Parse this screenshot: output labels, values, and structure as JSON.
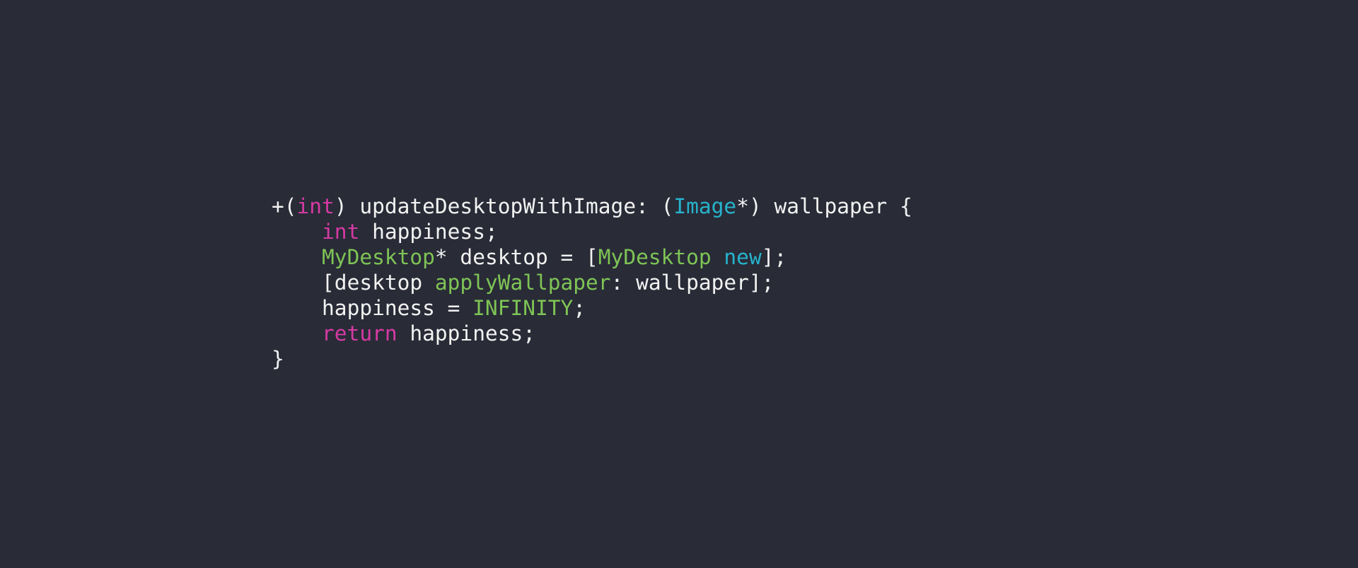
{
  "colors": {
    "background": "#292b37",
    "plain": "#f2f2f2",
    "keyword": "#d63aa4",
    "type": "#26b3cc",
    "class": "#7ec455"
  },
  "code": {
    "lines": [
      [
        {
          "t": "+(",
          "k": "plain"
        },
        {
          "t": "int",
          "k": "kw"
        },
        {
          "t": ") updateDesktopWithImage: (",
          "k": "plain"
        },
        {
          "t": "Image",
          "k": "type"
        },
        {
          "t": "*) wallpaper {",
          "k": "plain"
        }
      ],
      [
        {
          "t": "    ",
          "k": "plain"
        },
        {
          "t": "int",
          "k": "kw"
        },
        {
          "t": " happiness;",
          "k": "plain"
        }
      ],
      [
        {
          "t": "    ",
          "k": "plain"
        },
        {
          "t": "MyDesktop",
          "k": "cls"
        },
        {
          "t": "* desktop = [",
          "k": "plain"
        },
        {
          "t": "MyDesktop",
          "k": "cls"
        },
        {
          "t": " ",
          "k": "plain"
        },
        {
          "t": "new",
          "k": "type"
        },
        {
          "t": "];",
          "k": "plain"
        }
      ],
      [
        {
          "t": "    [desktop ",
          "k": "plain"
        },
        {
          "t": "applyWallpaper",
          "k": "cls"
        },
        {
          "t": ": wallpaper];",
          "k": "plain"
        }
      ],
      [
        {
          "t": "    happiness = ",
          "k": "plain"
        },
        {
          "t": "INFINITY",
          "k": "cls"
        },
        {
          "t": ";",
          "k": "plain"
        }
      ],
      [
        {
          "t": "    ",
          "k": "plain"
        },
        {
          "t": "return",
          "k": "kw"
        },
        {
          "t": " happiness;",
          "k": "plain"
        }
      ],
      [
        {
          "t": "}",
          "k": "plain"
        }
      ]
    ]
  }
}
